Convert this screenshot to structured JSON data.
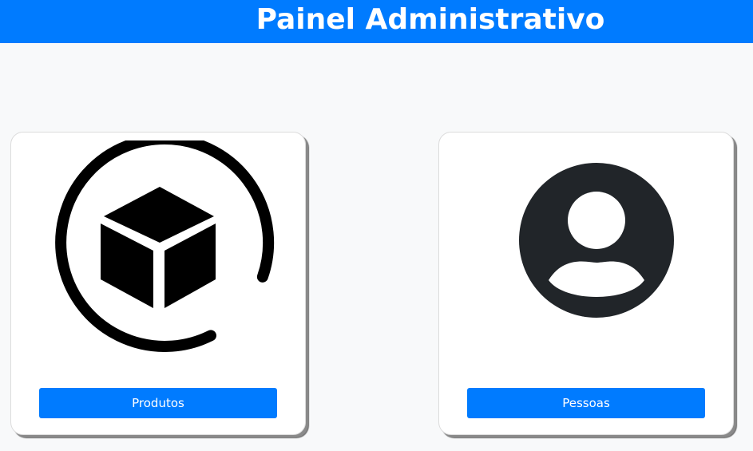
{
  "header": {
    "title": "Painel Administrativo"
  },
  "cards": [
    {
      "icon": "box-circle-icon",
      "button_label": "Produtos"
    },
    {
      "icon": "user-circle-icon",
      "button_label": "Pessoas"
    }
  ],
  "colors": {
    "header_bg": "#007bff",
    "button_bg": "#007bff",
    "page_bg": "#f8f9fa",
    "icon_dark": "#212529"
  }
}
